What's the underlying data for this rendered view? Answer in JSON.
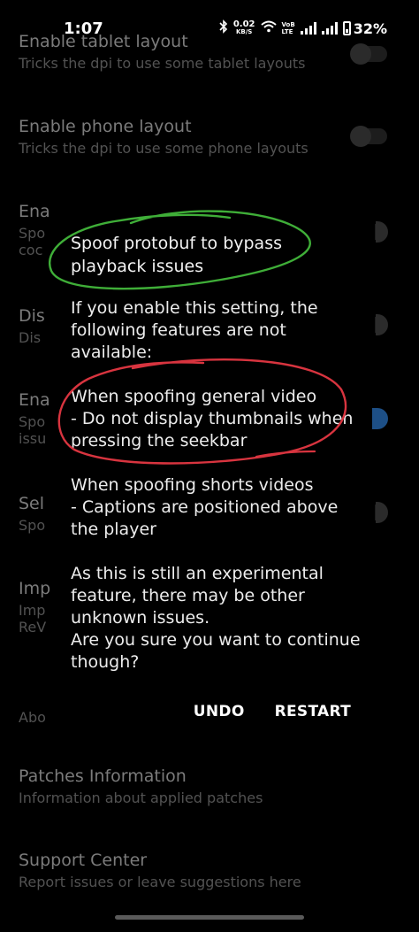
{
  "status_bar": {
    "time": "1:07",
    "net_speed": "0.02",
    "net_unit": "KB/S",
    "volte_top": "VoB",
    "volte_bottom": "LTE",
    "battery": "32%"
  },
  "settings": [
    {
      "title": "Enable tablet layout",
      "summary": "Tricks the dpi to use some tablet layouts"
    },
    {
      "title": "Enable phone layout",
      "summary": "Tricks the dpi to use some phone layouts"
    },
    {
      "title": "Ena",
      "summary_line1": "Spo",
      "summary_line2": "coc"
    },
    {
      "title": "Dis",
      "summary": "Dis"
    },
    {
      "title": "Ena",
      "summary_line1": "Spo",
      "summary_line2": "issu"
    },
    {
      "title": "Sel",
      "summary": "Spo"
    },
    {
      "title": "Imp",
      "summary_line1": "Imp",
      "summary_line2": "ReV"
    },
    {
      "title": "Abo"
    },
    {
      "title": "Patches Information",
      "summary": "Information about applied patches"
    },
    {
      "title": "Support Center",
      "summary": "Report issues or leave suggestions here"
    }
  ],
  "dialog": {
    "title": "Spoof protobuf to bypass playback issues",
    "intro": "If you enable this setting, the following features are not available:",
    "general_heading": "When spoofing general video",
    "general_item": "- Do not display thumbnails when pressing the seekbar",
    "shorts_heading": "When spoofing shorts videos",
    "shorts_item": "- Captions are positioned above the player",
    "warning": "As this is still an experimental feature, there may be other unknown issues.",
    "question": "Are you sure you want to continue though?",
    "undo_label": "UNDO",
    "restart_label": "RESTART"
  },
  "colors": {
    "annotation_green": "#3fae38",
    "annotation_red": "#d8343f",
    "switch_on": "#1d4f86"
  }
}
